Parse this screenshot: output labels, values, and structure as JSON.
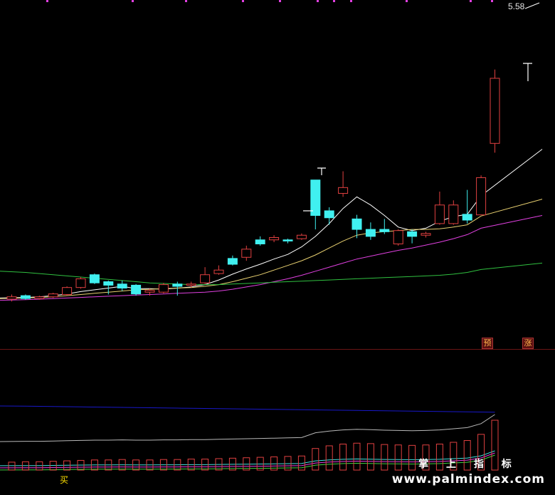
{
  "header": {
    "price_label": "5.58"
  },
  "signals": {
    "yu": "预",
    "zhang": "涨",
    "buy": "买"
  },
  "watermark": {
    "chinese": "掌 上 指 标",
    "url": "www.palmindex.com"
  },
  "colors": {
    "background": "#000000",
    "up": "#e04040",
    "down": "#40f0f0",
    "ma5": "#ffffff",
    "ma10": "#e8d070",
    "ma20": "#e040e0",
    "ma60": "#30c040",
    "divider": "#6b1515",
    "indicator_blue": "#1818c8",
    "indicator_gray": "#b8b8b8"
  },
  "chart_data": {
    "type": "candlestick",
    "candles": [
      {
        "o": 1.0,
        "c": 1.04,
        "h": 1.08,
        "l": 0.96
      },
      {
        "o": 1.06,
        "c": 1.01,
        "h": 1.08,
        "l": 0.99
      },
      {
        "o": 1.01,
        "c": 1.04,
        "h": 1.06,
        "l": 0.99
      },
      {
        "o": 1.04,
        "c": 1.09,
        "h": 1.11,
        "l": 1.02
      },
      {
        "o": 1.08,
        "c": 1.2,
        "h": 1.22,
        "l": 1.06
      },
      {
        "o": 1.2,
        "c": 1.35,
        "h": 1.38,
        "l": 1.18
      },
      {
        "o": 1.42,
        "c": 1.28,
        "h": 1.44,
        "l": 1.26
      },
      {
        "o": 1.3,
        "c": 1.24,
        "h": 1.32,
        "l": 1.08
      },
      {
        "o": 1.26,
        "c": 1.19,
        "h": 1.32,
        "l": 1.14
      },
      {
        "o": 1.24,
        "c": 1.09,
        "h": 1.26,
        "l": 1.06
      },
      {
        "o": 1.12,
        "c": 1.15,
        "h": 1.18,
        "l": 1.06
      },
      {
        "o": 1.12,
        "c": 1.25,
        "h": 1.28,
        "l": 1.1
      },
      {
        "o": 1.26,
        "c": 1.22,
        "h": 1.3,
        "l": 1.06
      },
      {
        "o": 1.24,
        "c": 1.26,
        "h": 1.3,
        "l": 1.2
      },
      {
        "o": 1.28,
        "c": 1.42,
        "h": 1.55,
        "l": 1.26
      },
      {
        "o": 1.44,
        "c": 1.5,
        "h": 1.58,
        "l": 1.42
      },
      {
        "o": 1.7,
        "c": 1.6,
        "h": 1.75,
        "l": 1.58
      },
      {
        "o": 1.72,
        "c": 1.86,
        "h": 1.92,
        "l": 1.66
      },
      {
        "o": 2.02,
        "c": 1.95,
        "h": 2.08,
        "l": 1.92
      },
      {
        "o": 2.02,
        "c": 2.06,
        "h": 2.1,
        "l": 1.98
      },
      {
        "o": 2.02,
        "c": 2.0,
        "h": 2.04,
        "l": 1.96
      },
      {
        "o": 2.04,
        "c": 2.1,
        "h": 2.13,
        "l": 2.02
      },
      {
        "o": 3.05,
        "c": 2.44,
        "h": 3.05,
        "l": 2.2
      },
      {
        "o": 2.52,
        "c": 2.4,
        "h": 2.58,
        "l": 2.28
      },
      {
        "o": 2.82,
        "c": 2.92,
        "h": 3.2,
        "l": 2.76
      },
      {
        "o": 2.38,
        "c": 2.2,
        "h": 2.45,
        "l": 2.05
      },
      {
        "o": 2.2,
        "c": 2.08,
        "h": 2.32,
        "l": 2.02
      },
      {
        "o": 2.2,
        "c": 2.16,
        "h": 2.38,
        "l": 2.12
      },
      {
        "o": 1.95,
        "c": 2.18,
        "h": 2.2,
        "l": 1.92
      },
      {
        "o": 2.16,
        "c": 2.08,
        "h": 2.2,
        "l": 1.96
      },
      {
        "o": 2.1,
        "c": 2.13,
        "h": 2.16,
        "l": 2.06
      },
      {
        "o": 2.3,
        "c": 2.62,
        "h": 2.85,
        "l": 2.28
      },
      {
        "o": 2.3,
        "c": 2.62,
        "h": 2.7,
        "l": 2.28
      },
      {
        "o": 2.46,
        "c": 2.36,
        "h": 2.88,
        "l": 2.3
      },
      {
        "o": 2.45,
        "c": 3.09,
        "h": 3.13,
        "l": 2.45
      },
      {
        "o": 3.68,
        "c": 4.8,
        "h": 4.95,
        "l": 3.52
      }
    ],
    "last_high": 5.58,
    "ma": [
      {
        "name": "MA5",
        "values": [
          1.02,
          1.03,
          1.04,
          1.06,
          1.09,
          1.13,
          1.16,
          1.19,
          1.22,
          1.18,
          1.18,
          1.17,
          1.19,
          1.21,
          1.25,
          1.33,
          1.43,
          1.52,
          1.6,
          1.69,
          1.77,
          1.9,
          2.08,
          2.3,
          2.56,
          2.76,
          2.62,
          2.44,
          2.24,
          2.18,
          2.22,
          2.34,
          2.42,
          2.46,
          2.78,
          3.58
        ]
      },
      {
        "name": "MA10",
        "values": [
          1.01,
          1.02,
          1.03,
          1.04,
          1.06,
          1.08,
          1.1,
          1.12,
          1.14,
          1.16,
          1.17,
          1.18,
          1.19,
          1.2,
          1.22,
          1.25,
          1.3,
          1.36,
          1.42,
          1.5,
          1.58,
          1.66,
          1.76,
          1.88,
          2.0,
          2.1,
          2.14,
          2.16,
          2.18,
          2.2,
          2.2,
          2.21,
          2.24,
          2.28,
          2.43,
          2.72
        ]
      },
      {
        "name": "MA20",
        "values": [
          0.98,
          0.99,
          1.0,
          1.01,
          1.02,
          1.03,
          1.04,
          1.05,
          1.06,
          1.07,
          1.08,
          1.09,
          1.1,
          1.11,
          1.12,
          1.14,
          1.17,
          1.21,
          1.25,
          1.3,
          1.35,
          1.41,
          1.48,
          1.55,
          1.62,
          1.69,
          1.74,
          1.79,
          1.84,
          1.88,
          1.93,
          1.98,
          2.04,
          2.11,
          2.22,
          2.44
        ]
      },
      {
        "name": "MA60",
        "values": [
          1.48,
          1.46,
          1.44,
          1.42,
          1.4,
          1.38,
          1.36,
          1.34,
          1.32,
          1.3,
          1.28,
          1.27,
          1.26,
          1.25,
          1.25,
          1.25,
          1.26,
          1.27,
          1.28,
          1.29,
          1.3,
          1.31,
          1.32,
          1.33,
          1.34,
          1.35,
          1.36,
          1.37,
          1.38,
          1.39,
          1.4,
          1.41,
          1.43,
          1.46,
          1.51,
          1.62
        ]
      }
    ],
    "indicator": {
      "bars": [
        0.05,
        0.06,
        0.06,
        0.07,
        0.08,
        0.09,
        0.1,
        0.1,
        0.11,
        0.1,
        0.1,
        0.11,
        0.11,
        0.12,
        0.12,
        0.13,
        0.14,
        0.15,
        0.16,
        0.17,
        0.18,
        0.19,
        0.36,
        0.42,
        0.46,
        0.48,
        0.47,
        0.45,
        0.44,
        0.43,
        0.44,
        0.46,
        0.5,
        0.54,
        0.68,
        1.0
      ],
      "blue_line": [
        0.9,
        0.89,
        0.88,
        0.87,
        0.86,
        0.85,
        0.84,
        0.83,
        0.82,
        0.81,
        0.8,
        0.79,
        0.78,
        0.77,
        0.76,
        0.75,
        0.74,
        0.73,
        0.72,
        0.71,
        0.7,
        0.69,
        0.68,
        0.67,
        0.66,
        0.65,
        0.64,
        0.63,
        0.62,
        0.61,
        0.6,
        0.59,
        0.58,
        0.57,
        0.56,
        0.55
      ]
    }
  }
}
